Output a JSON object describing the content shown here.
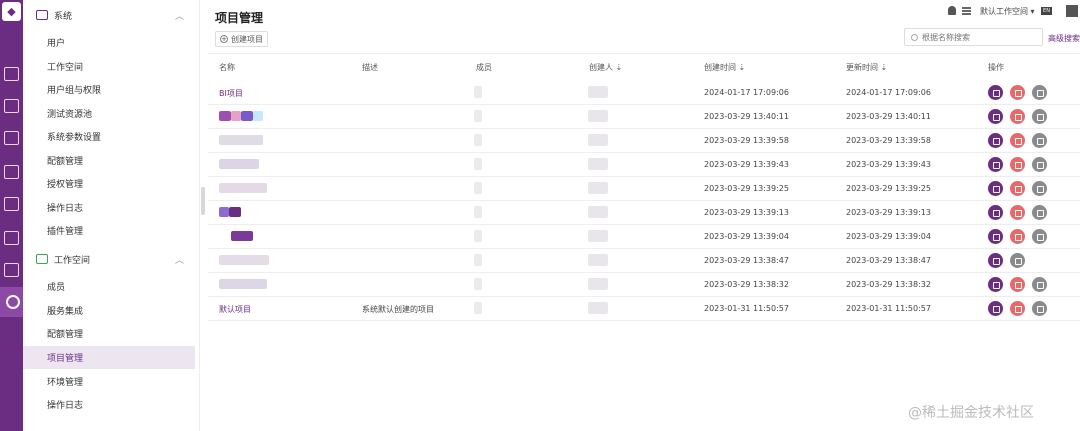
{
  "sidebar": {
    "system_group": "系统",
    "system_items": [
      "用户",
      "工作空间",
      "用户组与权限",
      "测试资源池",
      "系统参数设置",
      "配额管理",
      "授权管理",
      "操作日志",
      "插件管理"
    ],
    "workspace_group": "工作空间",
    "workspace_items": [
      "成员",
      "服务集成",
      "配额管理",
      "项目管理",
      "环境管理",
      "操作日志"
    ],
    "active_item": "项目管理"
  },
  "header": {
    "title": "项目管理",
    "create_label": "创建项目",
    "workspace_label": "默认工作空间",
    "lang_label": "EN",
    "search_placeholder": "根据名称搜索",
    "advanced_search": "高级搜索"
  },
  "table": {
    "columns": [
      "名称",
      "描述",
      "成员",
      "创建人",
      "创建时间",
      "更新时间",
      "操作"
    ],
    "rows": [
      {
        "name": "BI项目",
        "desc": "",
        "created": "2024-01-17 17:09:06",
        "updated": "2024-01-17 17:09:06",
        "actions": [
          "edit",
          "delete",
          "settings"
        ]
      },
      {
        "name": "",
        "desc": "",
        "created": "2023-03-29 13:40:11",
        "updated": "2023-03-29 13:40:11",
        "actions": [
          "edit",
          "delete",
          "settings"
        ]
      },
      {
        "name": "",
        "desc": "",
        "created": "2023-03-29 13:39:58",
        "updated": "2023-03-29 13:39:58",
        "actions": [
          "edit",
          "delete",
          "settings"
        ]
      },
      {
        "name": "",
        "desc": "",
        "created": "2023-03-29 13:39:43",
        "updated": "2023-03-29 13:39:43",
        "actions": [
          "edit",
          "delete",
          "settings"
        ]
      },
      {
        "name": "",
        "desc": "",
        "created": "2023-03-29 13:39:25",
        "updated": "2023-03-29 13:39:25",
        "actions": [
          "edit",
          "delete",
          "settings"
        ]
      },
      {
        "name": "",
        "desc": "",
        "created": "2023-03-29 13:39:13",
        "updated": "2023-03-29 13:39:13",
        "actions": [
          "edit",
          "delete",
          "settings"
        ]
      },
      {
        "name": "",
        "desc": "",
        "created": "2023-03-29 13:39:04",
        "updated": "2023-03-29 13:39:04",
        "actions": [
          "edit",
          "delete",
          "settings"
        ]
      },
      {
        "name": "",
        "desc": "",
        "created": "2023-03-29 13:38:47",
        "updated": "2023-03-29 13:38:47",
        "actions": [
          "edit",
          "settings"
        ]
      },
      {
        "name": "",
        "desc": "",
        "created": "2023-03-29 13:38:32",
        "updated": "2023-03-29 13:38:32",
        "actions": [
          "edit",
          "delete",
          "settings"
        ]
      },
      {
        "name": "默认项目",
        "desc": "系统默认创建的项目",
        "created": "2023-01-31 11:50:57",
        "updated": "2023-01-31 11:50:57",
        "actions": [
          "edit",
          "delete",
          "settings"
        ]
      }
    ]
  },
  "watermark": "@稀土掘金技术社区",
  "colors": {
    "brand": "#6a2d82",
    "delete": "#e66a6a",
    "settings": "#8a8a8a"
  }
}
